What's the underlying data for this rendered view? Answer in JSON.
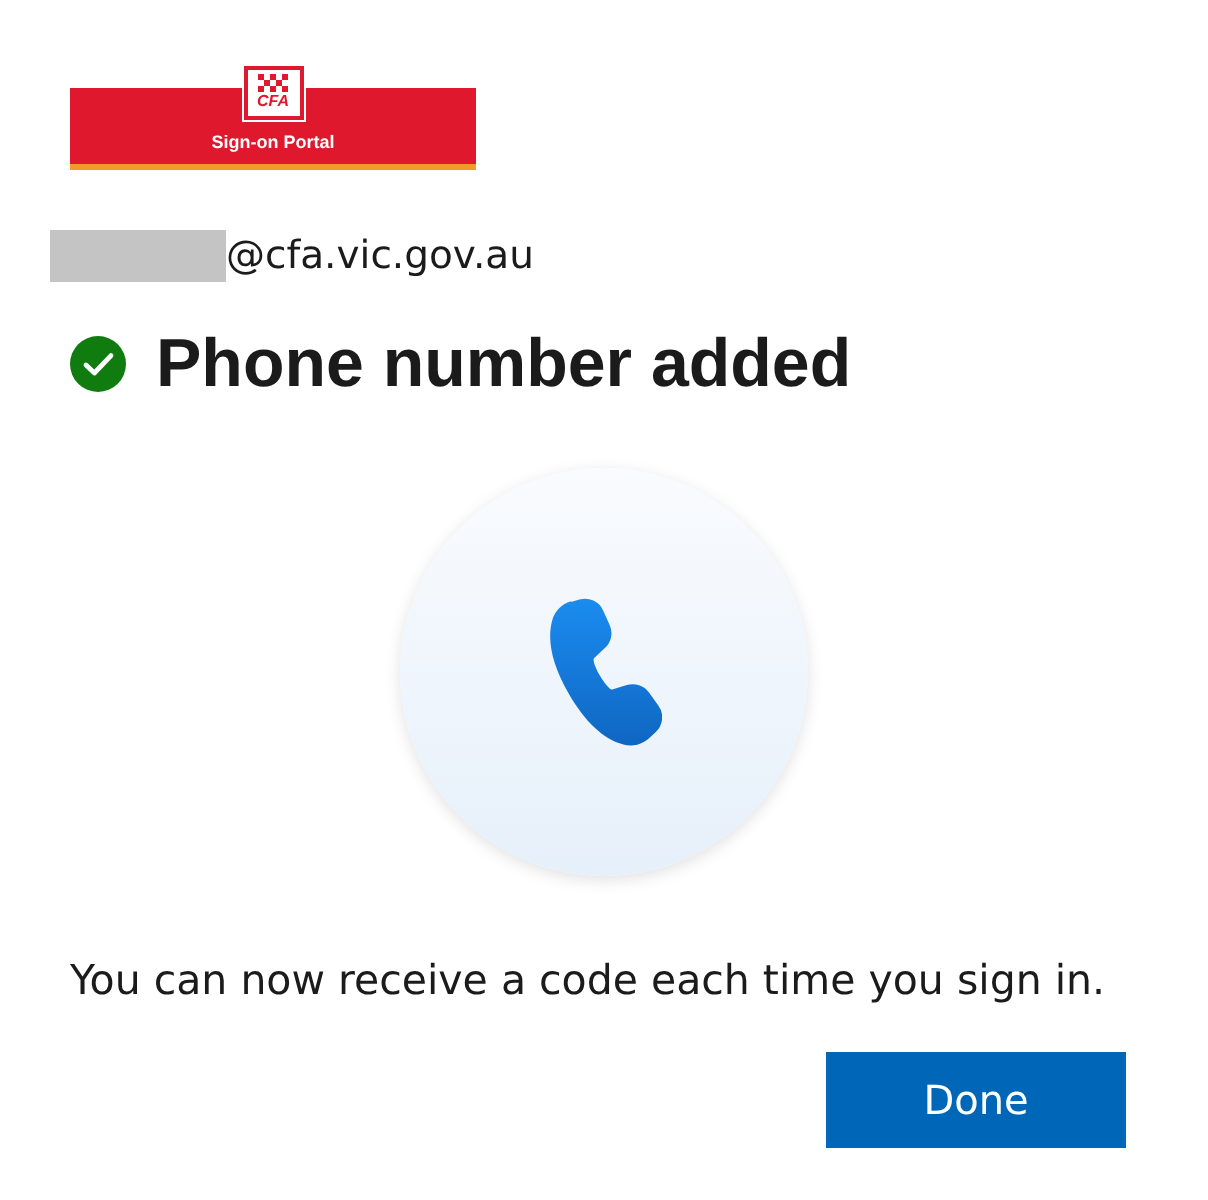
{
  "logo": {
    "emblem_text": "CFA",
    "caption": "Sign-on Portal"
  },
  "account": {
    "email_suffix": "@cfa.vic.gov.au"
  },
  "title": {
    "text": "Phone number added",
    "success": true
  },
  "message": "You can now receive a code each time you sign in.",
  "buttons": [
    {
      "label": "Done",
      "kind": "primary"
    }
  ]
}
